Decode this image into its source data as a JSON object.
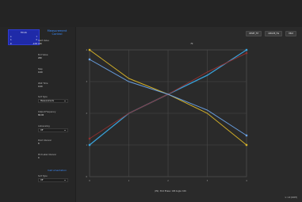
{
  "toolbar": {
    "buttons": [
      {
        "label": "RESET_FIT"
      },
      {
        "label": "UPDATE_FIG"
      },
      {
        "label": "HELP"
      }
    ]
  },
  "left": {
    "mini_table": {
      "header": "Fit Info",
      "rows": [
        {
          "k": "a",
          "v": "1"
        },
        {
          "k": "b",
          "v": "0"
        },
        {
          "k": "R",
          "v": "-0.83"
        }
      ]
    },
    "section_title": "Measurement\nControl",
    "fields": [
      {
        "label": "Start Value",
        "value": "100"
      },
      {
        "label": "End Value",
        "value": "200"
      },
      {
        "label": "Step",
        "value": "0.00"
      },
      {
        "label": "Wait Time",
        "value": "0.00"
      },
      {
        "label": "Sort Type",
        "select": "Measurements"
      },
      {
        "label": "Output Frequency",
        "value": "60.00"
      },
      {
        "label": "Autoscaling",
        "select": "Off"
      },
      {
        "label": "Point Interval",
        "value": "8"
      },
      {
        "label": "Plot Label Interval",
        "value": "0"
      }
    ],
    "section_title_2": "Instrumentation",
    "instrument": {
      "label": "Sort Type",
      "select": "Off"
    }
  },
  "plot": {
    "title": "Fit",
    "status": "(PS): 36.0 Phase: 148 Angle: 106",
    "footer_right": "x: 1.0 (1007)"
  },
  "chart_data": {
    "type": "line",
    "title": "Fit",
    "x": [
      0,
      1,
      2,
      3,
      4
    ],
    "series": [
      {
        "values": [
          1,
          2,
          2.6,
          3.2,
          4
        ]
      },
      {
        "values": [
          4,
          3.1,
          2.6,
          2.0,
          1.0
        ]
      },
      {
        "values": [
          1.2,
          2.0,
          2.6,
          3.3,
          3.9
        ]
      },
      {
        "values": [
          3.7,
          3.0,
          2.6,
          2.1,
          1.3
        ]
      }
    ],
    "colors": [
      "#3aa6e0",
      "#d8b428",
      "#8f3030",
      "#6aa2e6"
    ],
    "xlim": [
      0,
      4
    ],
    "ylim": [
      0,
      4
    ],
    "grid": true
  },
  "ui_colors": {
    "accent": "#3b8cff",
    "mini_table_bg": "#1f2aa8"
  }
}
